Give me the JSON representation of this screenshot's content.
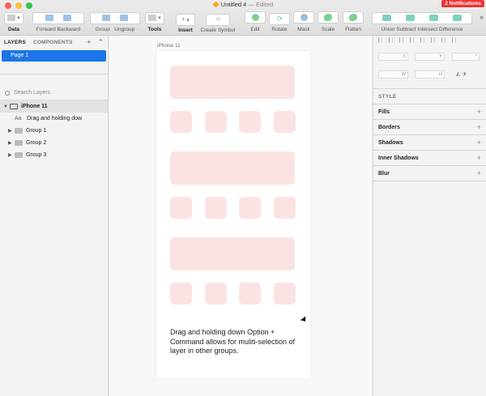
{
  "window": {
    "title": "Untitled 4",
    "status": "— Edited",
    "notifications": "2 Notifications"
  },
  "toolbar": {
    "data_label": "Data",
    "forward_label": "Forward",
    "backward_label": "Backward",
    "group_label": "Group",
    "ungroup_label": "Ungroup",
    "tools_label": "Tools",
    "insert_label": "Insert",
    "create_symbol_label": "Create Symbol",
    "edit_label": "Edit",
    "rotate_label": "Rotate",
    "mask_label": "Mask",
    "scale_label": "Scale",
    "flatten_label": "Flatten",
    "union_label": "Union",
    "subtract_label": "Subtract",
    "intersect_label": "Intersect",
    "difference_label": "Difference",
    "insert_button": "+",
    "more": "»"
  },
  "left_panel": {
    "tabs": [
      "LAYERS",
      "COMPONENTS"
    ],
    "page": "Page 1",
    "search_placeholder": "Search Layers",
    "artboard": "iPhone 11",
    "layers": [
      {
        "type": "text",
        "icon": "Aa",
        "label": "Drag and holding dow"
      },
      {
        "type": "group",
        "label": "Group 1"
      },
      {
        "type": "group",
        "label": "Group 2"
      },
      {
        "type": "group",
        "label": "Group 3"
      }
    ]
  },
  "canvas": {
    "artboard_label": "iPhone 11",
    "caption": "Drag and holding down Option + Command allows for muliti-selection of layer in other groups.",
    "shape_color": "#fbe3e4"
  },
  "inspector": {
    "x_label": "X",
    "y_label": "Y",
    "w_label": "W",
    "h_label": "H",
    "degree_symbol": "°",
    "style_label": "STYLE",
    "sections": [
      "Fills",
      "Borders",
      "Shadows",
      "Inner Shadows",
      "Blur"
    ]
  },
  "colors": {
    "selection": "#1b74e8",
    "notification": "#ee3333"
  }
}
